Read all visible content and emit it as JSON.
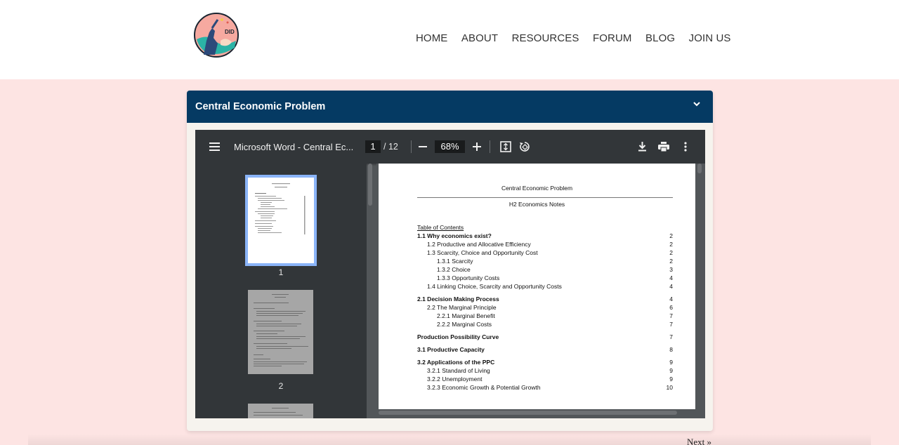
{
  "nav": {
    "items": [
      {
        "label": "HOME"
      },
      {
        "label": "ABOUT"
      },
      {
        "label": "RESOURCES"
      },
      {
        "label": "FORUM"
      },
      {
        "label": "BLOG"
      },
      {
        "label": "JOIN US"
      }
    ]
  },
  "logo": {
    "text": "DID"
  },
  "card": {
    "title": "Central Economic Problem"
  },
  "viewer": {
    "title": "Microsoft Word - Central Ec...",
    "current_page": "1",
    "total_pages": "/ 12",
    "zoom": "68%",
    "thumbnails": [
      {
        "num": "1"
      },
      {
        "num": "2"
      }
    ]
  },
  "document": {
    "title": "Central Economic Problem",
    "subtitle": "H2 Economics Notes",
    "toc_heading": "Table of Contents",
    "toc": [
      {
        "text": "1.1 Why economics exist?",
        "page": "2",
        "bold": true,
        "level": 0
      },
      {
        "text": "1.2 Productive and Allocative Efficiency",
        "page": "2",
        "bold": false,
        "level": 1
      },
      {
        "text": "1.3 Scarcity, Choice and Opportunity Cost",
        "page": "2",
        "bold": false,
        "level": 1
      },
      {
        "text": "1.3.1 Scarcity",
        "page": "2",
        "bold": false,
        "level": 2
      },
      {
        "text": "1.3.2 Choice",
        "page": "3",
        "bold": false,
        "level": 2
      },
      {
        "text": "1.3.3 Opportunity Costs",
        "page": "4",
        "bold": false,
        "level": 2
      },
      {
        "text": "1.4 Linking Choice, Scarcity and Opportunity Costs",
        "page": "4",
        "bold": false,
        "level": 1
      },
      {
        "text": "2.1 Decision Making Process",
        "page": "4",
        "bold": true,
        "level": 0
      },
      {
        "text": "2.2 The Marginal Principle",
        "page": "6",
        "bold": false,
        "level": 1
      },
      {
        "text": "2.2.1 Marginal Benefit",
        "page": "7",
        "bold": false,
        "level": 2
      },
      {
        "text": "2.2.2 Marginal Costs",
        "page": "7",
        "bold": false,
        "level": 2
      },
      {
        "text": "Production Possibility Curve",
        "page": "7",
        "bold": true,
        "level": 0
      },
      {
        "text": "3.1 Productive Capacity",
        "page": "8",
        "bold": true,
        "level": 0
      },
      {
        "text": "3.2 Applications of the PPC",
        "page": "9",
        "bold": true,
        "level": 0
      },
      {
        "text": "3.2.1 Standard of Living",
        "page": "9",
        "bold": false,
        "level": 1
      },
      {
        "text": "3.2.2 Unemployment",
        "page": "9",
        "bold": false,
        "level": 1
      },
      {
        "text": "3.2.3 Economic Growth & Potential Growth",
        "page": "10",
        "bold": false,
        "level": 1
      }
    ]
  },
  "pagination": {
    "next": "Next »"
  },
  "colors": {
    "header_bar": "#053a63",
    "page_bg": "#fde4e3",
    "toolbar": "#323639",
    "thumb_selected": "#8ab4f8"
  }
}
